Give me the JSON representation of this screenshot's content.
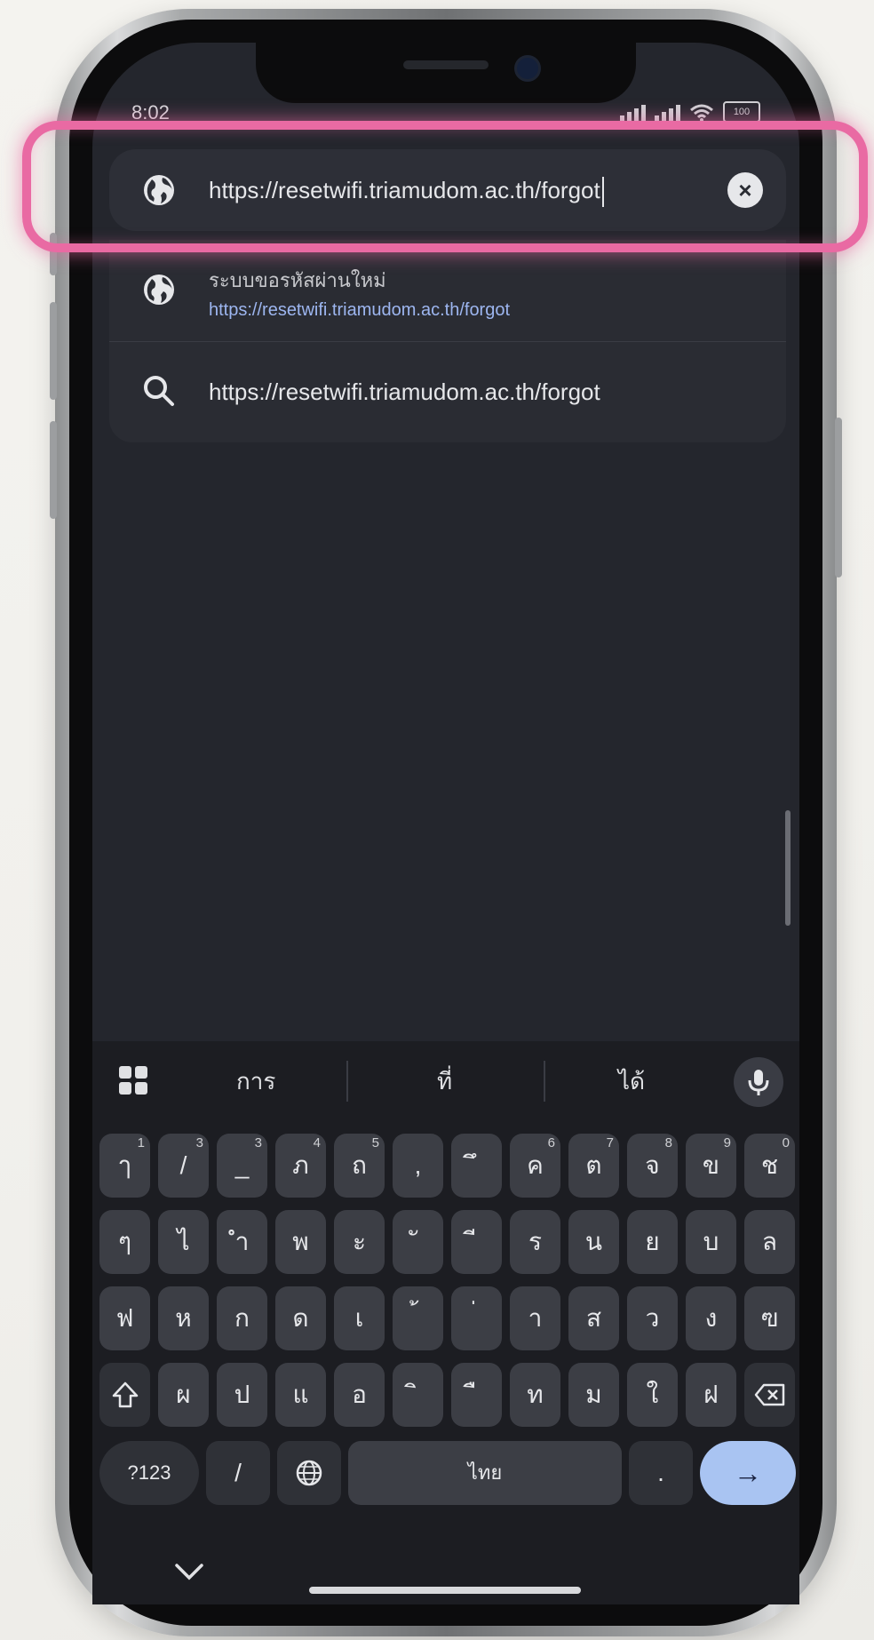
{
  "status_bar": {
    "time": "8:02",
    "battery_label": "100"
  },
  "url_bar": {
    "value": "https://resetwifi.triamudom.ac.th/forgot",
    "clear_icon": "close-circle-icon"
  },
  "suggestions": [
    {
      "icon": "globe-icon",
      "title": "ระบบขอรหัสผ่านใหม่",
      "url": "https://resetwifi.triamudom.ac.th/forgot"
    },
    {
      "icon": "search-icon",
      "text": "https://resetwifi.triamudom.ac.th/forgot"
    }
  ],
  "keyboard": {
    "suggestion_words": [
      "การ",
      "ที่",
      "ได้"
    ],
    "row1": [
      {
        "label": "ๅ",
        "num": "1"
      },
      {
        "label": "/",
        "num": "3"
      },
      {
        "label": "_",
        "num": "3"
      },
      {
        "label": "ภ",
        "num": "4"
      },
      {
        "label": "ถ",
        "num": "5"
      },
      {
        "label": ",",
        "num": ""
      },
      {
        "label": "ึ",
        "num": ""
      },
      {
        "label": "ค",
        "num": "6"
      },
      {
        "label": "ต",
        "num": "7"
      },
      {
        "label": "จ",
        "num": "8"
      },
      {
        "label": "ข",
        "num": "9"
      },
      {
        "label": "ช",
        "num": "0"
      }
    ],
    "row2": [
      "ๆ",
      "ไ",
      "ำ",
      "พ",
      "ะ",
      "ั",
      "ี",
      "ร",
      "น",
      "ย",
      "บ",
      "ล"
    ],
    "row3": [
      "ฟ",
      "ห",
      "ก",
      "ด",
      "เ",
      "้",
      "่",
      "า",
      "ส",
      "ว",
      "ง",
      "ฃ"
    ],
    "row4": [
      "ผ",
      "ป",
      "แ",
      "อ",
      "ิ",
      "ื",
      "ท",
      "ม",
      "ใ",
      "ฝ"
    ],
    "symbols_label": "?123",
    "slash_label": "/",
    "space_label": "ไทย",
    "period_label": ".",
    "enter_label": "→",
    "shift_icon": "shift-icon",
    "backspace_icon": "backspace-icon",
    "language_icon": "globe-icon"
  }
}
